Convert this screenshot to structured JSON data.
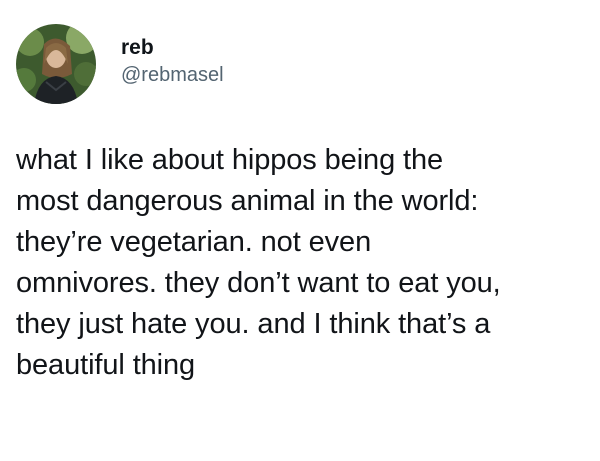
{
  "author": {
    "display_name": "reb",
    "handle": "@rebmasel",
    "avatar_icon": "profile-photo"
  },
  "tweet": {
    "lines": [
      "what I like about hippos being the",
      "most dangerous animal in the world:",
      "they’re vegetarian. not even",
      "omnivores. they don’t want to eat you,",
      "they just hate you. and I think that’s a",
      "beautiful thing"
    ]
  },
  "colors": {
    "text": "#0f1419",
    "secondary_text": "#536471",
    "background": "#ffffff"
  }
}
